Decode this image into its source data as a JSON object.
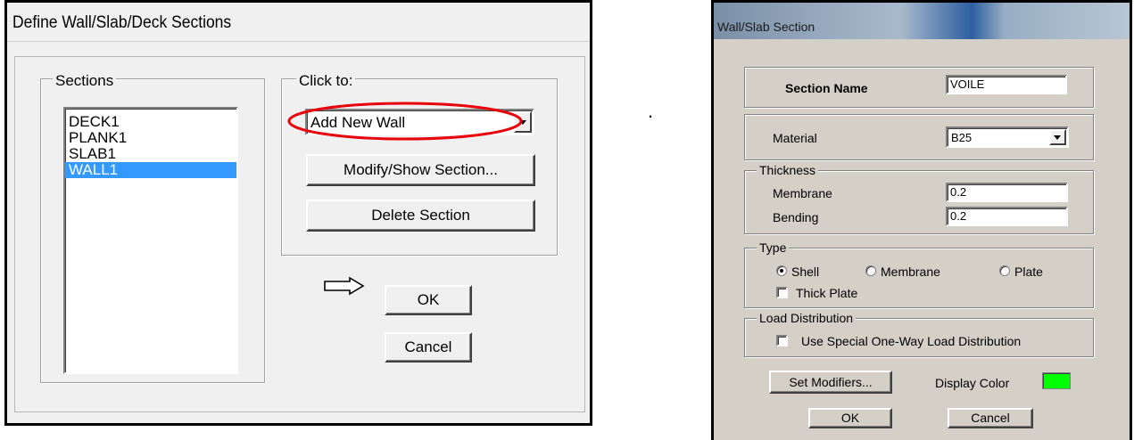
{
  "define_dialog": {
    "title": "Define Wall/Slab/Deck Sections",
    "sections_label": "Sections",
    "sections": [
      "DECK1",
      "PLANK1",
      "SLAB1",
      "WALL1"
    ],
    "selected_section": "WALL1",
    "click_to_label": "Click to:",
    "add_combo_value": "Add New Wall",
    "modify_button": "Modify/Show Section...",
    "delete_button": "Delete Section",
    "ok_button": "OK",
    "cancel_button": "Cancel",
    "annotation_color": "#e8000a",
    "selection_color": "#3399ff"
  },
  "separator_dot": ".",
  "section_dialog": {
    "title": "Wall/Slab Section",
    "section_name_label": "Section Name",
    "section_name_value": "VOILE",
    "material_label": "Material",
    "material_value": "B25",
    "thickness_label": "Thickness",
    "membrane_label": "Membrane",
    "membrane_value": "0.2",
    "bending_label": "Bending",
    "bending_value": "0.2",
    "type_label": "Type",
    "type_options": [
      "Shell",
      "Membrane",
      "Plate"
    ],
    "type_selected": "Shell",
    "thick_plate_label": "Thick Plate",
    "thick_plate_checked": false,
    "load_distribution_label": "Load Distribution",
    "special_load_label": "Use Special One-Way Load Distribution",
    "special_load_checked": false,
    "set_modifiers_button": "Set Modifiers...",
    "display_color_label": "Display Color",
    "display_color_value": "#00ff00",
    "ok_button": "OK",
    "cancel_button": "Cancel"
  }
}
